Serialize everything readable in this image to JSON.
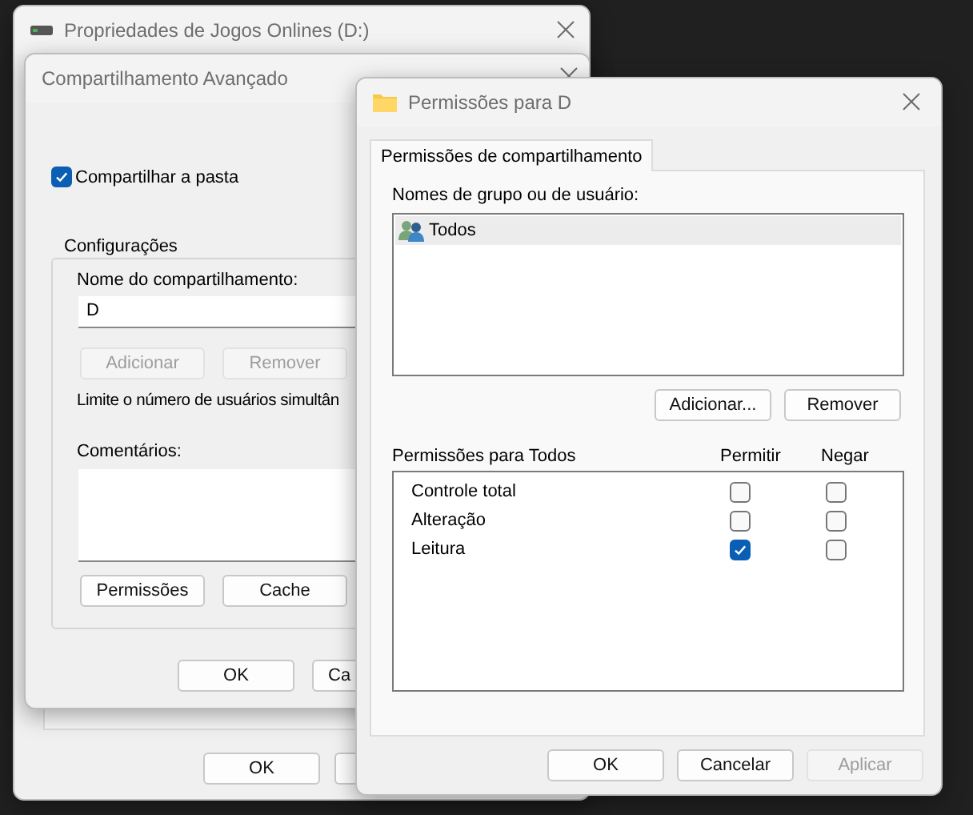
{
  "properties_window": {
    "title": "Propriedades de Jogos Onlines (D:)",
    "buttons": [
      {
        "label": "OK"
      }
    ]
  },
  "advanced_window": {
    "title": "Compartilhamento Avançado",
    "share_checkbox": {
      "label": "Compartilhar a pasta",
      "checked": true
    },
    "settings": {
      "title": "Configurações",
      "share_name_label": "Nome do compartilhamento:",
      "share_name_value": "D",
      "name_buttons": [
        {
          "label": "Adicionar",
          "disabled": true
        },
        {
          "label": "Remover",
          "disabled": true
        }
      ],
      "limit_text": "Limite o número de usuários simultân",
      "comments_label": "Comentários:",
      "buttons": [
        {
          "label": "Permissões",
          "disabled": false
        },
        {
          "label": "Cache",
          "disabled": false
        }
      ]
    },
    "buttons": [
      {
        "label": "OK"
      },
      {
        "label": "Ca"
      }
    ]
  },
  "permissions_window": {
    "title": "Permissões para D",
    "tabs": [
      {
        "label": "Permissões de compartilhamento",
        "selected": true
      }
    ],
    "users_label": "Nomes de grupo ou de usuário:",
    "users": [
      {
        "name": "Todos",
        "selected": true
      }
    ],
    "user_buttons": [
      {
        "label": "Adicionar...",
        "disabled": false
      },
      {
        "label": "Remover",
        "disabled": false
      }
    ],
    "permissions_label": "Permissões para Todos",
    "columns": [
      "Permitir",
      "Negar"
    ],
    "permissions": [
      {
        "name": "Controle total",
        "allow": false,
        "deny": false
      },
      {
        "name": "Alteração",
        "allow": false,
        "deny": false
      },
      {
        "name": "Leitura",
        "allow": true,
        "deny": false
      }
    ],
    "buttons": [
      {
        "label": "OK",
        "disabled": false
      },
      {
        "label": "Cancelar",
        "disabled": false
      },
      {
        "label": "Aplicar",
        "disabled": true
      }
    ]
  }
}
